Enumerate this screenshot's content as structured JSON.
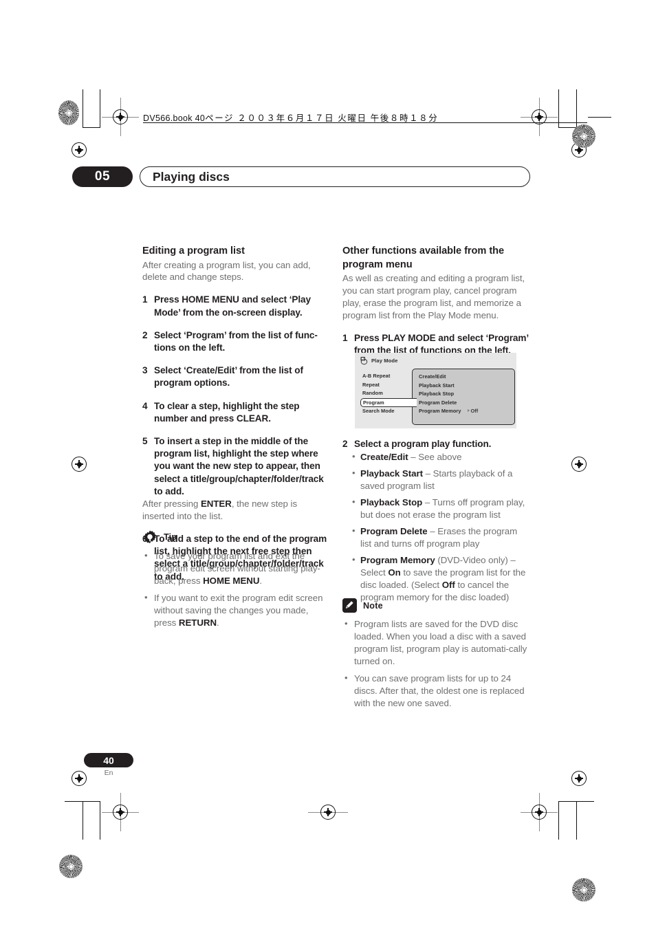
{
  "header": {
    "book_line_prefix": "DV566.book",
    "book_line_page": "40",
    "book_line_jp": "ページ  ２００３年６月１７日   火曜日   午後８時１８分"
  },
  "chapter": {
    "number": "05",
    "title": "Playing discs"
  },
  "left_column": {
    "section_title": "Editing a program list",
    "intro": "After creating a program list, you can add, delete and change steps.",
    "steps": [
      {
        "num": "1",
        "text": "Press HOME MENU and select ‘Play Mode’ from the on-screen display."
      },
      {
        "num": "2",
        "text": "Select ‘Program’ from the list of func-tions on the left."
      },
      {
        "num": "3",
        "text": "Select ‘Create/Edit’ from the list of program options."
      },
      {
        "num": "4",
        "text": "To clear a step, highlight the step number and press CLEAR."
      },
      {
        "num": "5",
        "text": "To insert a step in the middle of the program list, highlight the step where you want the new step to appear, then select a title/group/chapter/folder/track to add."
      },
      {
        "num": "6",
        "text": "To add a step to the end of the program list, highlight the next free step then select a title/group/chapter/folder/track to add."
      }
    ],
    "step5_note_pre": "After pressing ",
    "step5_note_bold": "ENTER",
    "step5_note_post": ", the new step is inserted into the list.",
    "tip": {
      "label": "Tip",
      "icon": "gear-icon",
      "bullets": [
        {
          "pre": "To save your program list and exit the program edit screen without starting play-back, press  ",
          "bold": "HOME MENU",
          "post": "."
        },
        {
          "pre": "If you want to exit the program edit screen without saving the changes you made, press ",
          "bold": "RETURN",
          "post": "."
        }
      ]
    }
  },
  "right_column": {
    "section_title": "Other functions available from the program menu",
    "intro": "As well as creating and editing a program list, you can start program play, cancel program play, erase the program list, and memorize a program list from the Play Mode menu.",
    "step1": {
      "num": "1",
      "text": "Press PLAY MODE and select ‘Program’ from the list of functions on the left."
    },
    "step2": {
      "num": "2",
      "text": "Select a program play function."
    },
    "functions": [
      {
        "bold": "Create/Edit",
        "rest": " – See above"
      },
      {
        "bold": "Playback Start",
        "rest": " – Starts playback of a saved program list"
      },
      {
        "bold": "Playback Stop",
        "rest": " – Turns off program play, but does not erase the program list"
      },
      {
        "bold": "Program Delete",
        "rest": " – Erases the program list and turns off program play"
      }
    ],
    "program_memory": {
      "bold": "Program Memory",
      "part1": " (DVD-Video only) – Select ",
      "bold2": "On",
      "part2": " to save the program list for the disc loaded. (Select ",
      "bold3": "Off",
      "part3": " to cancel the program memory for the disc loaded)"
    },
    "note": {
      "label": "Note",
      "icon": "pencil-note-icon",
      "bullets": [
        "Program lists are saved for the DVD disc loaded. When you load a disc with a saved program list, program play is automati-cally turned on.",
        "You can save program lists for up to 24 discs. After that, the oldest one is replaced with the new one saved."
      ]
    }
  },
  "osd": {
    "title": "Play Mode",
    "title_icon": "play-mode-screen-icon",
    "left_items": [
      {
        "label": "A-B Repeat",
        "selected": false
      },
      {
        "label": "Repeat",
        "selected": false
      },
      {
        "label": "Random",
        "selected": false
      },
      {
        "label": "Program",
        "selected": true
      },
      {
        "label": "Search Mode",
        "selected": false
      }
    ],
    "panel_rows": [
      {
        "label": "Create/Edit",
        "value": ""
      },
      {
        "label": "Playback Start",
        "value": ""
      },
      {
        "label": "Playback Stop",
        "value": ""
      },
      {
        "label": "Program Delete",
        "value": ""
      },
      {
        "label": "Program Memory",
        "value": "Off"
      }
    ]
  },
  "footer": {
    "page_number": "40",
    "language": "En"
  }
}
